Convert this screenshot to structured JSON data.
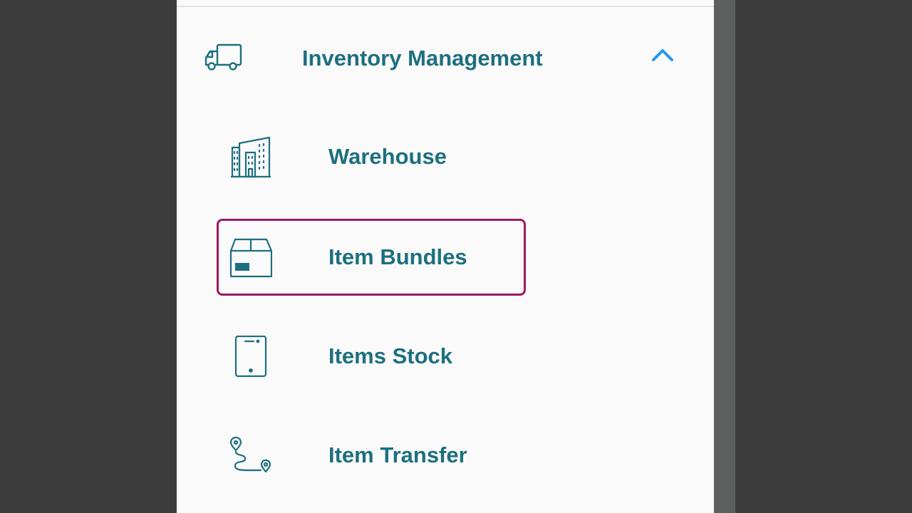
{
  "section": {
    "label": "Inventory Management",
    "icon": "truck-icon",
    "expanded": true
  },
  "menu": {
    "items": [
      {
        "label": "Warehouse",
        "icon": "buildings-icon",
        "selected": false
      },
      {
        "label": "Item Bundles",
        "icon": "box-icon",
        "selected": true
      },
      {
        "label": "Items Stock",
        "icon": "tablet-icon",
        "selected": false
      },
      {
        "label": "Item Transfer",
        "icon": "route-icon",
        "selected": false
      }
    ]
  },
  "colors": {
    "text": "#1d6f80",
    "chevron": "#2196f3",
    "selection_border": "#9b1b62",
    "panel_bg": "#fafafa",
    "page_bg": "#3c3c3c"
  }
}
